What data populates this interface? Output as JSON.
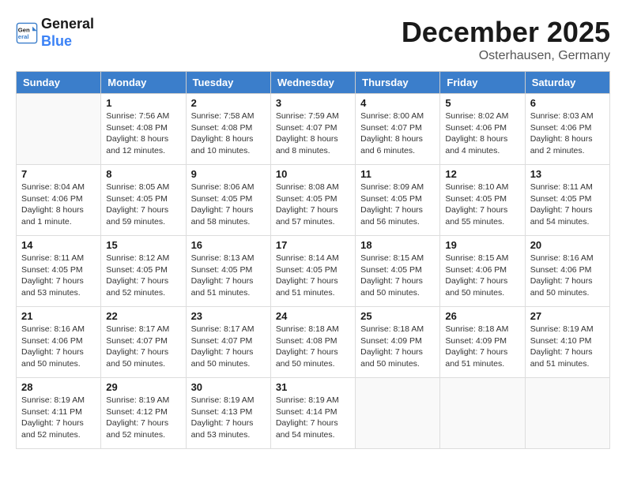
{
  "header": {
    "logo_line1": "General",
    "logo_line2": "Blue",
    "month": "December 2025",
    "location": "Osterhausen, Germany"
  },
  "weekdays": [
    "Sunday",
    "Monday",
    "Tuesday",
    "Wednesday",
    "Thursday",
    "Friday",
    "Saturday"
  ],
  "weeks": [
    [
      {
        "day": "",
        "info": ""
      },
      {
        "day": "1",
        "info": "Sunrise: 7:56 AM\nSunset: 4:08 PM\nDaylight: 8 hours\nand 12 minutes."
      },
      {
        "day": "2",
        "info": "Sunrise: 7:58 AM\nSunset: 4:08 PM\nDaylight: 8 hours\nand 10 minutes."
      },
      {
        "day": "3",
        "info": "Sunrise: 7:59 AM\nSunset: 4:07 PM\nDaylight: 8 hours\nand 8 minutes."
      },
      {
        "day": "4",
        "info": "Sunrise: 8:00 AM\nSunset: 4:07 PM\nDaylight: 8 hours\nand 6 minutes."
      },
      {
        "day": "5",
        "info": "Sunrise: 8:02 AM\nSunset: 4:06 PM\nDaylight: 8 hours\nand 4 minutes."
      },
      {
        "day": "6",
        "info": "Sunrise: 8:03 AM\nSunset: 4:06 PM\nDaylight: 8 hours\nand 2 minutes."
      }
    ],
    [
      {
        "day": "7",
        "info": "Sunrise: 8:04 AM\nSunset: 4:06 PM\nDaylight: 8 hours\nand 1 minute."
      },
      {
        "day": "8",
        "info": "Sunrise: 8:05 AM\nSunset: 4:05 PM\nDaylight: 7 hours\nand 59 minutes."
      },
      {
        "day": "9",
        "info": "Sunrise: 8:06 AM\nSunset: 4:05 PM\nDaylight: 7 hours\nand 58 minutes."
      },
      {
        "day": "10",
        "info": "Sunrise: 8:08 AM\nSunset: 4:05 PM\nDaylight: 7 hours\nand 57 minutes."
      },
      {
        "day": "11",
        "info": "Sunrise: 8:09 AM\nSunset: 4:05 PM\nDaylight: 7 hours\nand 56 minutes."
      },
      {
        "day": "12",
        "info": "Sunrise: 8:10 AM\nSunset: 4:05 PM\nDaylight: 7 hours\nand 55 minutes."
      },
      {
        "day": "13",
        "info": "Sunrise: 8:11 AM\nSunset: 4:05 PM\nDaylight: 7 hours\nand 54 minutes."
      }
    ],
    [
      {
        "day": "14",
        "info": "Sunrise: 8:11 AM\nSunset: 4:05 PM\nDaylight: 7 hours\nand 53 minutes."
      },
      {
        "day": "15",
        "info": "Sunrise: 8:12 AM\nSunset: 4:05 PM\nDaylight: 7 hours\nand 52 minutes."
      },
      {
        "day": "16",
        "info": "Sunrise: 8:13 AM\nSunset: 4:05 PM\nDaylight: 7 hours\nand 51 minutes."
      },
      {
        "day": "17",
        "info": "Sunrise: 8:14 AM\nSunset: 4:05 PM\nDaylight: 7 hours\nand 51 minutes."
      },
      {
        "day": "18",
        "info": "Sunrise: 8:15 AM\nSunset: 4:05 PM\nDaylight: 7 hours\nand 50 minutes."
      },
      {
        "day": "19",
        "info": "Sunrise: 8:15 AM\nSunset: 4:06 PM\nDaylight: 7 hours\nand 50 minutes."
      },
      {
        "day": "20",
        "info": "Sunrise: 8:16 AM\nSunset: 4:06 PM\nDaylight: 7 hours\nand 50 minutes."
      }
    ],
    [
      {
        "day": "21",
        "info": "Sunrise: 8:16 AM\nSunset: 4:06 PM\nDaylight: 7 hours\nand 50 minutes."
      },
      {
        "day": "22",
        "info": "Sunrise: 8:17 AM\nSunset: 4:07 PM\nDaylight: 7 hours\nand 50 minutes."
      },
      {
        "day": "23",
        "info": "Sunrise: 8:17 AM\nSunset: 4:07 PM\nDaylight: 7 hours\nand 50 minutes."
      },
      {
        "day": "24",
        "info": "Sunrise: 8:18 AM\nSunset: 4:08 PM\nDaylight: 7 hours\nand 50 minutes."
      },
      {
        "day": "25",
        "info": "Sunrise: 8:18 AM\nSunset: 4:09 PM\nDaylight: 7 hours\nand 50 minutes."
      },
      {
        "day": "26",
        "info": "Sunrise: 8:18 AM\nSunset: 4:09 PM\nDaylight: 7 hours\nand 51 minutes."
      },
      {
        "day": "27",
        "info": "Sunrise: 8:19 AM\nSunset: 4:10 PM\nDaylight: 7 hours\nand 51 minutes."
      }
    ],
    [
      {
        "day": "28",
        "info": "Sunrise: 8:19 AM\nSunset: 4:11 PM\nDaylight: 7 hours\nand 52 minutes."
      },
      {
        "day": "29",
        "info": "Sunrise: 8:19 AM\nSunset: 4:12 PM\nDaylight: 7 hours\nand 52 minutes."
      },
      {
        "day": "30",
        "info": "Sunrise: 8:19 AM\nSunset: 4:13 PM\nDaylight: 7 hours\nand 53 minutes."
      },
      {
        "day": "31",
        "info": "Sunrise: 8:19 AM\nSunset: 4:14 PM\nDaylight: 7 hours\nand 54 minutes."
      },
      {
        "day": "",
        "info": ""
      },
      {
        "day": "",
        "info": ""
      },
      {
        "day": "",
        "info": ""
      }
    ]
  ]
}
